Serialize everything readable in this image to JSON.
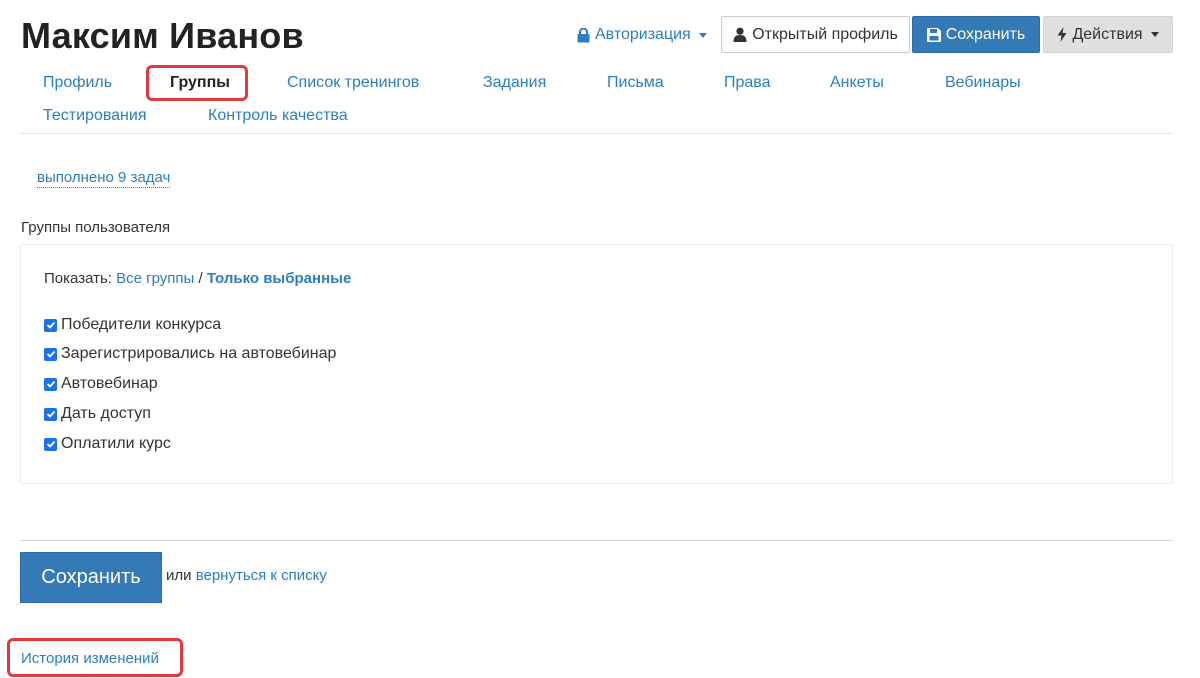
{
  "header": {
    "title": "Максим Иванов",
    "auth_dropdown": "Авторизация",
    "open_profile_button": "Открытый профиль",
    "save_button": "Сохранить",
    "actions_button": "Действия"
  },
  "tabs": [
    {
      "label": "Профиль"
    },
    {
      "label": "Группы",
      "active": true
    },
    {
      "label": "Список тренингов"
    },
    {
      "label": "Задания"
    },
    {
      "label": "Письма"
    },
    {
      "label": "Права"
    },
    {
      "label": "Анкеты"
    },
    {
      "label": "Вебинары"
    },
    {
      "label": "Тестирования"
    },
    {
      "label": "Контроль качества"
    }
  ],
  "tasks_link": "выполнено 9 задач",
  "groups_section": {
    "label": "Группы пользователя",
    "filter": {
      "prefix": "Показать:",
      "all_label": "Все группы",
      "separator": "/",
      "selected_label": "Только выбранные"
    },
    "groups": [
      {
        "label": "Победители конкурса",
        "checked": true
      },
      {
        "label": "Зарегистрировались на автовебинар",
        "checked": true
      },
      {
        "label": "Автовебинар",
        "checked": true
      },
      {
        "label": "Дать доступ",
        "checked": true
      },
      {
        "label": "Оплатили курс",
        "checked": true
      }
    ]
  },
  "footer": {
    "save_button": "Сохранить",
    "or_text": "или",
    "back_link": "вернуться к списку",
    "history_link": "История изменений"
  },
  "colors": {
    "link": "#2d7ec1",
    "primary": "#337ab7",
    "highlight": "#e03a3a",
    "checkbox": "#1a73e8"
  }
}
